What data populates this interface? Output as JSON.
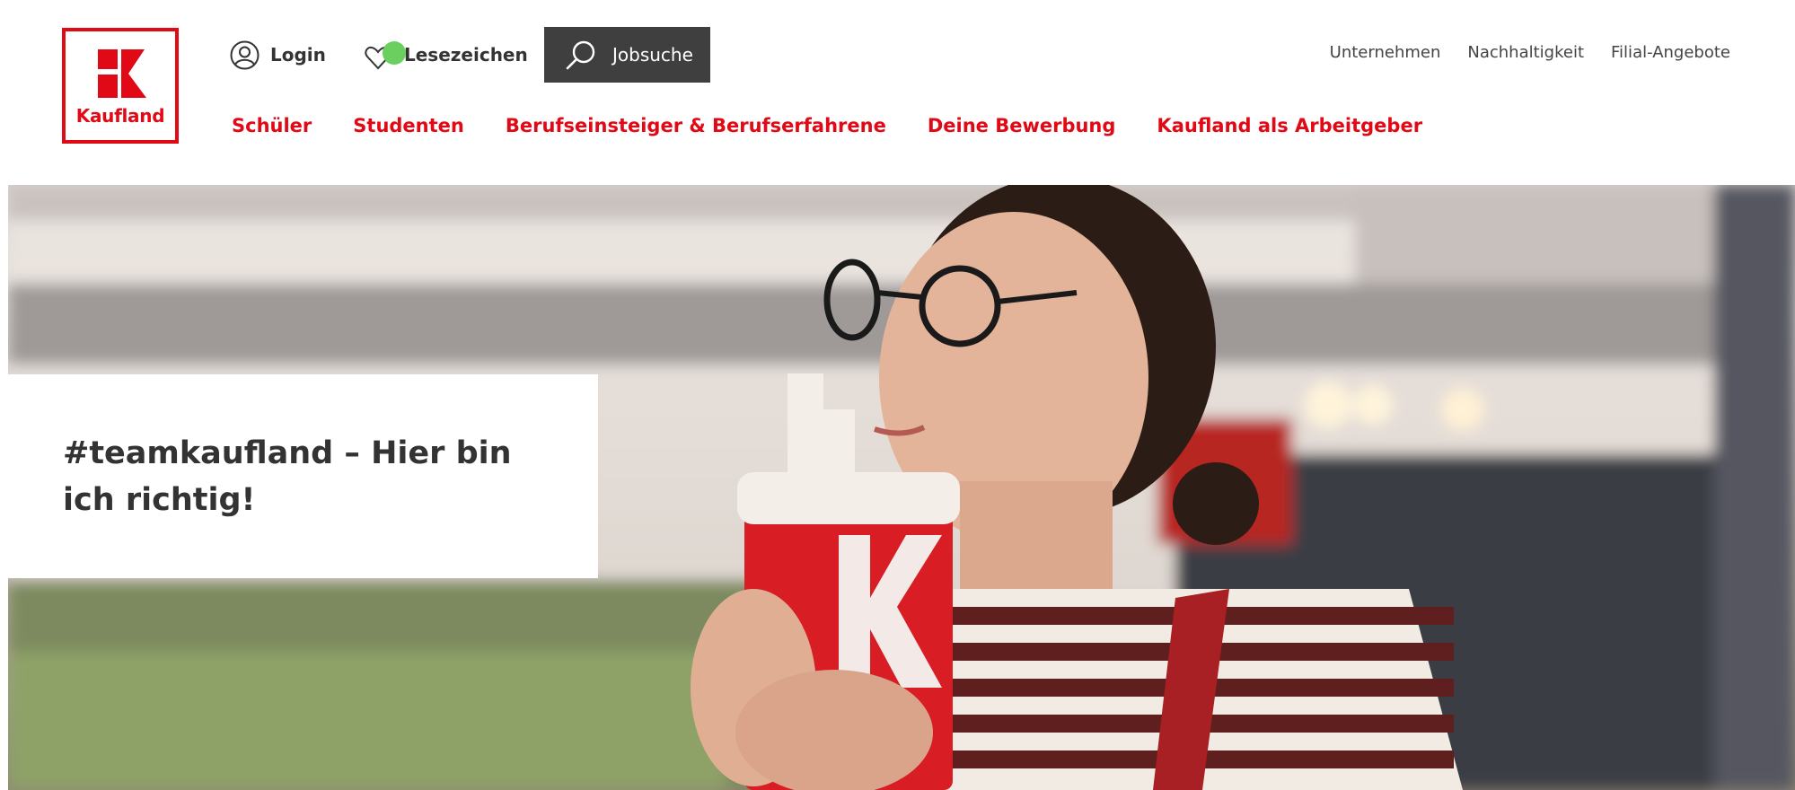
{
  "brand": {
    "name": "Kaufland",
    "accent": "#e10915"
  },
  "header": {
    "login_label": "Login",
    "bookmarks_label": "Lesezeichen",
    "jobsearch_label": "Jobsuche",
    "top_links": [
      "Unternehmen",
      "Nachhaltigkeit",
      "Filial-Angebote"
    ],
    "nav": [
      "Schüler",
      "Studenten",
      "Berufseinsteiger & Berufserfahrene",
      "Deine Bewerbung",
      "Kaufland als Arbeitgeber"
    ]
  },
  "icons": {
    "login": "user-circle-icon",
    "bookmarks": "heart-icon",
    "search": "search-icon"
  },
  "hero": {
    "title": "#teamkaufland – Hier bin ich richtig!",
    "image": "woman-with-red-kaufland-cup-photo"
  }
}
